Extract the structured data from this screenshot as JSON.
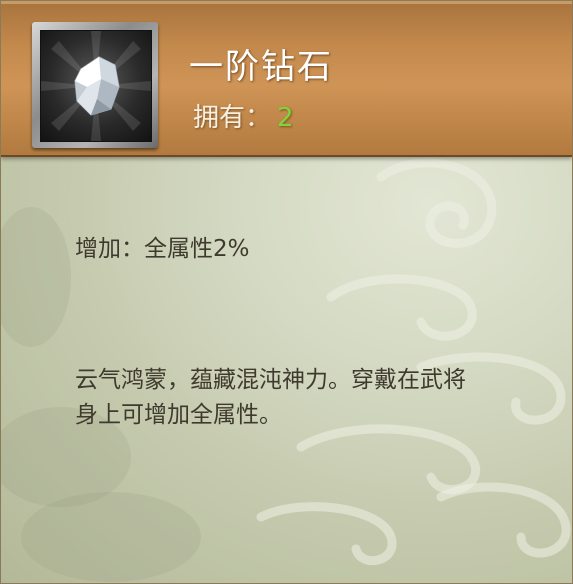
{
  "item": {
    "name": "一阶钻石",
    "icon": "white-diamond-gem-icon",
    "owned_label": "拥有：",
    "owned_count": "2"
  },
  "stats": {
    "bonus_text": "增加：全属性2%"
  },
  "description": {
    "text": "云气鸿蒙，蕴藏混沌神力。穿戴在武将身上可增加全属性。"
  },
  "colors": {
    "header": "#c48a4d",
    "body_bg": "#d5dac4",
    "owned_count": "#7cd63a",
    "body_text": "#3f3a2e"
  }
}
